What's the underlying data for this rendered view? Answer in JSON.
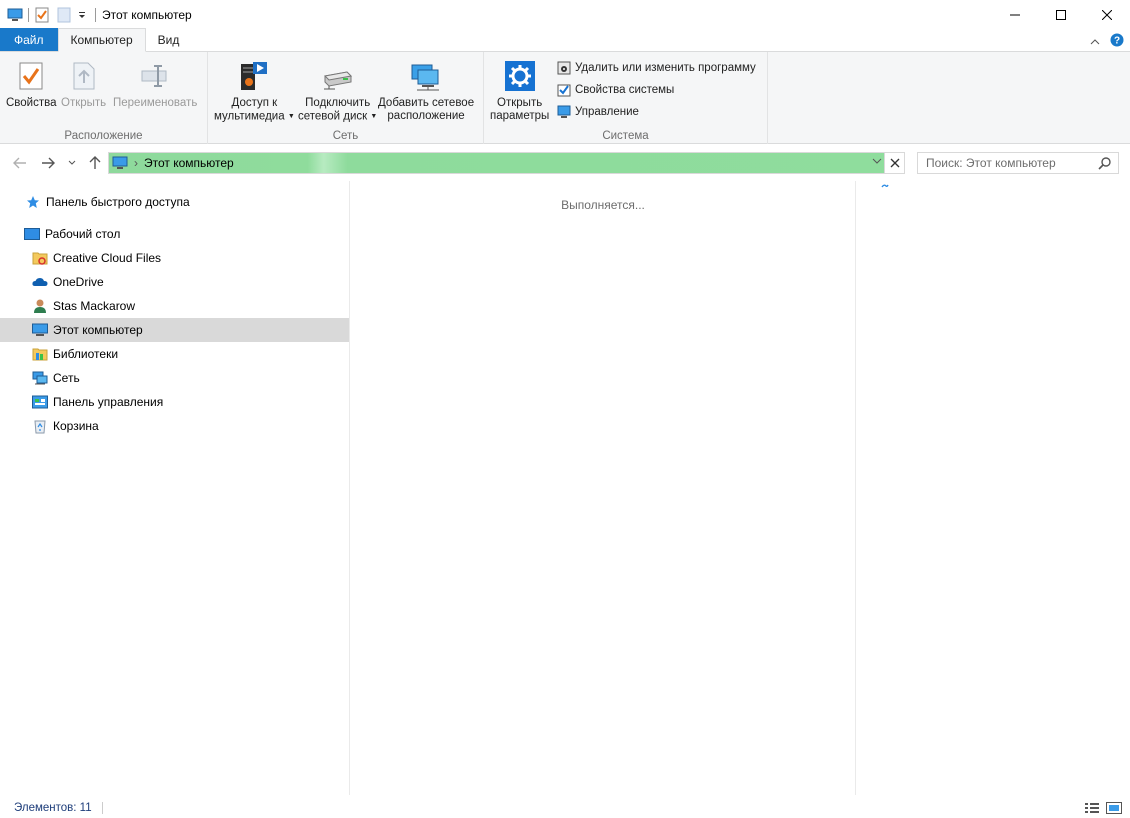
{
  "window": {
    "title": "Этот компьютер"
  },
  "ribbon_tabs": {
    "file": "Файл",
    "computer": "Компьютер",
    "view": "Вид"
  },
  "ribbon": {
    "location_group": {
      "label": "Расположение",
      "properties": "Свойства",
      "open": "Открыть",
      "rename": "Переименовать"
    },
    "network_group": {
      "label": "Сеть",
      "media_access_line1": "Доступ к",
      "media_access_line2": "мультимедиа",
      "map_drive_line1": "Подключить",
      "map_drive_line2": "сетевой диск",
      "add_location_line1": "Добавить сетевое",
      "add_location_line2": "расположение"
    },
    "system_group": {
      "label": "Система",
      "open_settings_line1": "Открыть",
      "open_settings_line2": "параметры",
      "uninstall": "Удалить или изменить программу",
      "system_properties": "Свойства системы",
      "manage": "Управление"
    }
  },
  "address": {
    "path": "Этот компьютер",
    "separator": "›",
    "search_placeholder": "Поиск: Этот компьютер"
  },
  "nav_pane": {
    "items": [
      {
        "label": "Панель быстрого доступа",
        "icon": "star-icon"
      },
      {
        "label": "Рабочий стол",
        "icon": "desktop-icon"
      },
      {
        "label": "Creative Cloud Files",
        "icon": "creative-cloud-folder-icon"
      },
      {
        "label": "OneDrive",
        "icon": "onedrive-cloud-icon"
      },
      {
        "label": "Stas Mackarow",
        "icon": "user-icon"
      },
      {
        "label": "Этот компьютер",
        "icon": "computer-icon",
        "selected": true
      },
      {
        "label": "Библиотеки",
        "icon": "libraries-icon"
      },
      {
        "label": "Сеть",
        "icon": "network-icon"
      },
      {
        "label": "Панель управления",
        "icon": "control-panel-icon"
      },
      {
        "label": "Корзина",
        "icon": "recycle-bin-icon"
      }
    ]
  },
  "content": {
    "status_text": "Выполняется..."
  },
  "status_bar": {
    "items_count": "Элементов: 11"
  },
  "colors": {
    "file_tab": "#1979ca",
    "address_progress": "#8fdc9c",
    "selection": "#d9d9d9",
    "ribbon_bg": "#f5f6f7"
  }
}
